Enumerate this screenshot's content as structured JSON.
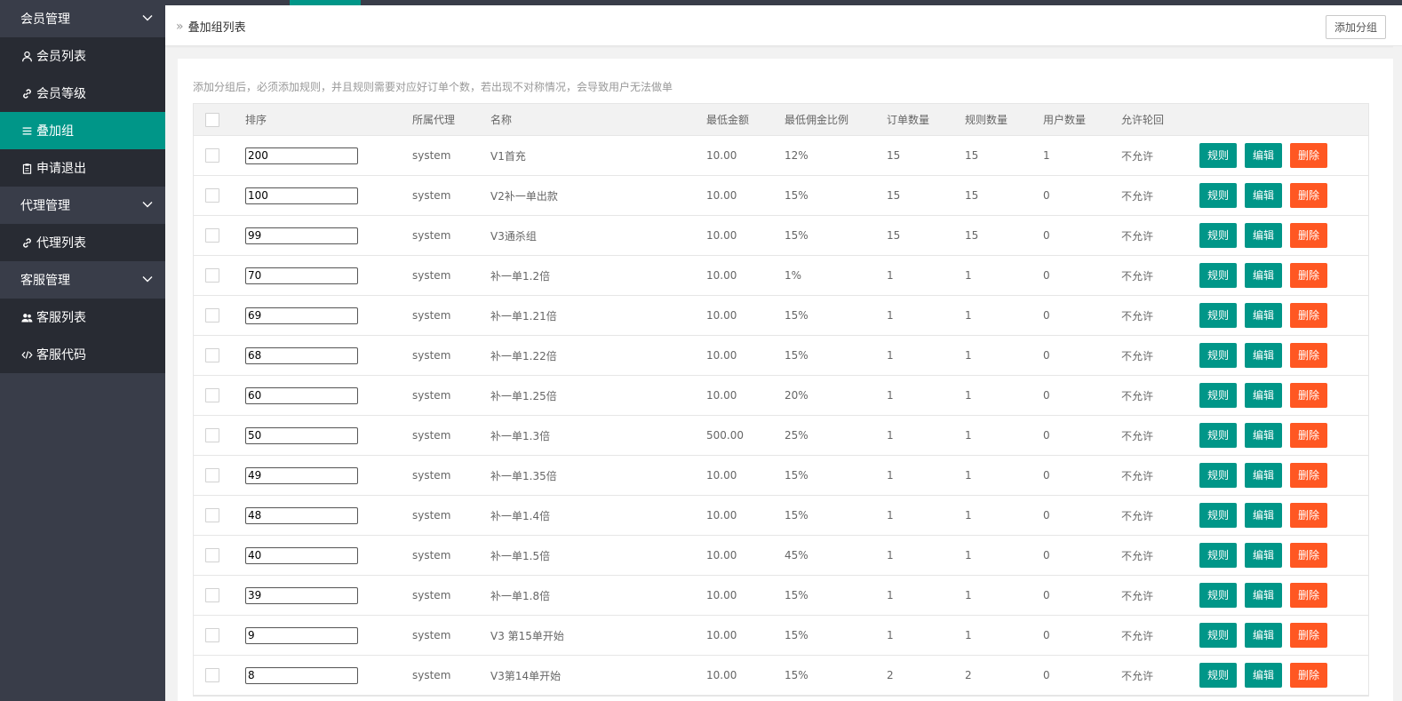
{
  "sidebar": {
    "groups": [
      {
        "label": "会员管理",
        "items": [
          {
            "label": "会员列表",
            "icon": "user-icon"
          },
          {
            "label": "会员等级",
            "icon": "link-icon"
          },
          {
            "label": "叠加组",
            "icon": "list-icon",
            "active": true
          },
          {
            "label": "申请退出",
            "icon": "clipboard-icon"
          }
        ]
      },
      {
        "label": "代理管理",
        "items": [
          {
            "label": "代理列表",
            "icon": "link-icon"
          }
        ]
      },
      {
        "label": "客服管理",
        "items": [
          {
            "label": "客服列表",
            "icon": "users-icon"
          },
          {
            "label": "客服代码",
            "icon": "code-icon"
          }
        ]
      }
    ]
  },
  "header": {
    "breadcrumb_sep": "»",
    "breadcrumb": "叠加组列表",
    "add_group_button": "添加分组"
  },
  "notice": "添加分组后，必须添加规则，并且规则需要对应好订单个数，若出现不对称情况，会导致用户无法做单",
  "table": {
    "headers": {
      "sort": "排序",
      "agent": "所属代理",
      "name": "名称",
      "min_amount": "最低金额",
      "ratio": "最低佣金比例",
      "orders": "订单数量",
      "rules": "规则数量",
      "users": "用户数量",
      "allow": "允许轮回"
    },
    "buttons": {
      "rules": "规则",
      "edit": "编辑",
      "delete": "删除"
    },
    "rows": [
      {
        "sort": "200",
        "agent": "system",
        "name": "V1首充",
        "min": "10.00",
        "ratio": "12%",
        "orders": "15",
        "rules": "15",
        "users": "1",
        "allow": "不允许"
      },
      {
        "sort": "100",
        "agent": "system",
        "name": "V2补一单出款",
        "min": "10.00",
        "ratio": "15%",
        "orders": "15",
        "rules": "15",
        "users": "0",
        "allow": "不允许"
      },
      {
        "sort": "99",
        "agent": "system",
        "name": "V3通杀组",
        "min": "10.00",
        "ratio": "15%",
        "orders": "15",
        "rules": "15",
        "users": "0",
        "allow": "不允许"
      },
      {
        "sort": "70",
        "agent": "system",
        "name": "补一单1.2倍",
        "min": "10.00",
        "ratio": "1%",
        "orders": "1",
        "rules": "1",
        "users": "0",
        "allow": "不允许"
      },
      {
        "sort": "69",
        "agent": "system",
        "name": "补一单1.21倍",
        "min": "10.00",
        "ratio": "15%",
        "orders": "1",
        "rules": "1",
        "users": "0",
        "allow": "不允许"
      },
      {
        "sort": "68",
        "agent": "system",
        "name": "补一单1.22倍",
        "min": "10.00",
        "ratio": "15%",
        "orders": "1",
        "rules": "1",
        "users": "0",
        "allow": "不允许"
      },
      {
        "sort": "60",
        "agent": "system",
        "name": "补一单1.25倍",
        "min": "10.00",
        "ratio": "20%",
        "orders": "1",
        "rules": "1",
        "users": "0",
        "allow": "不允许"
      },
      {
        "sort": "50",
        "agent": "system",
        "name": "补一单1.3倍",
        "min": "500.00",
        "ratio": "25%",
        "orders": "1",
        "rules": "1",
        "users": "0",
        "allow": "不允许"
      },
      {
        "sort": "49",
        "agent": "system",
        "name": "补一单1.35倍",
        "min": "10.00",
        "ratio": "15%",
        "orders": "1",
        "rules": "1",
        "users": "0",
        "allow": "不允许"
      },
      {
        "sort": "48",
        "agent": "system",
        "name": "补一单1.4倍",
        "min": "10.00",
        "ratio": "15%",
        "orders": "1",
        "rules": "1",
        "users": "0",
        "allow": "不允许"
      },
      {
        "sort": "40",
        "agent": "system",
        "name": "补一单1.5倍",
        "min": "10.00",
        "ratio": "45%",
        "orders": "1",
        "rules": "1",
        "users": "0",
        "allow": "不允许"
      },
      {
        "sort": "39",
        "agent": "system",
        "name": "补一单1.8倍",
        "min": "10.00",
        "ratio": "15%",
        "orders": "1",
        "rules": "1",
        "users": "0",
        "allow": "不允许"
      },
      {
        "sort": "9",
        "agent": "system",
        "name": "V3 第15单开始",
        "min": "10.00",
        "ratio": "15%",
        "orders": "1",
        "rules": "1",
        "users": "0",
        "allow": "不允许"
      },
      {
        "sort": "8",
        "agent": "system",
        "name": "V3第14单开始",
        "min": "10.00",
        "ratio": "15%",
        "orders": "2",
        "rules": "2",
        "users": "0",
        "allow": "不允许"
      }
    ]
  },
  "colors": {
    "accent": "#009688",
    "danger": "#ff5722",
    "sidebar": "#393d49",
    "sidebar_child": "#282b33"
  }
}
